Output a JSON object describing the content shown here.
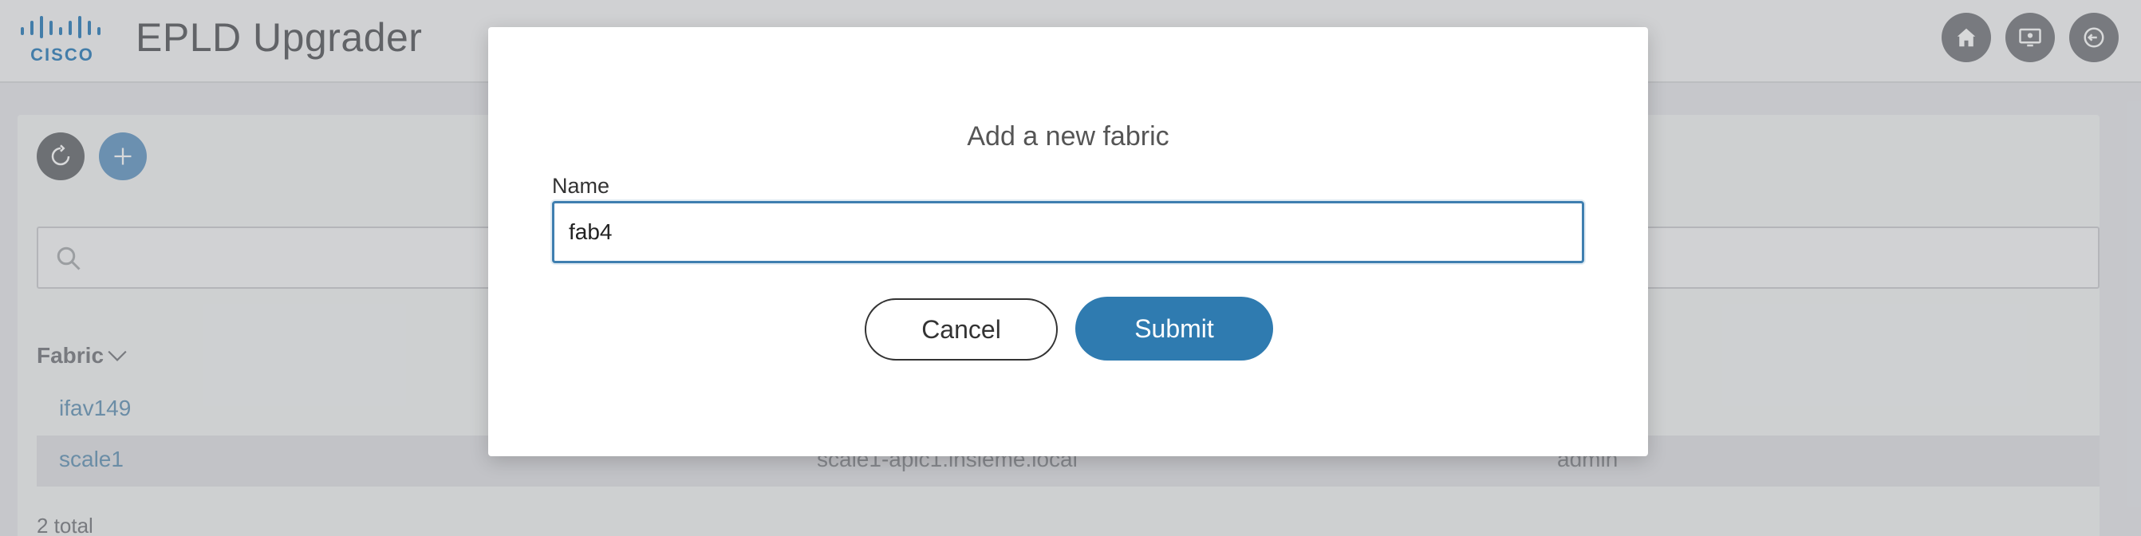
{
  "header": {
    "app_title": "EPLD Upgrader",
    "logo_text": "CISCO",
    "buttons": [
      {
        "icon": "home-icon"
      },
      {
        "icon": "monitor-icon"
      },
      {
        "icon": "logout-icon"
      }
    ]
  },
  "toolbar": {
    "refresh_icon": "refresh-icon",
    "add_icon": "plus-icon"
  },
  "search": {
    "placeholder": "",
    "icon": "search-icon"
  },
  "table": {
    "column_fabric": "Fabric",
    "rows": [
      {
        "fabric": "ifav149",
        "host": "",
        "user": ""
      },
      {
        "fabric": "scale1",
        "host": "scale1-apic1.insieme.local",
        "user": "admin"
      }
    ],
    "total": "2 total"
  },
  "modal": {
    "title": "Add a new fabric",
    "name_label": "Name",
    "name_value": "fab4",
    "cancel_label": "Cancel",
    "submit_label": "Submit"
  },
  "colors": {
    "accent": "#2f7bb0",
    "header_bg": "#f6f6f7",
    "link": "#7aa3c0"
  }
}
